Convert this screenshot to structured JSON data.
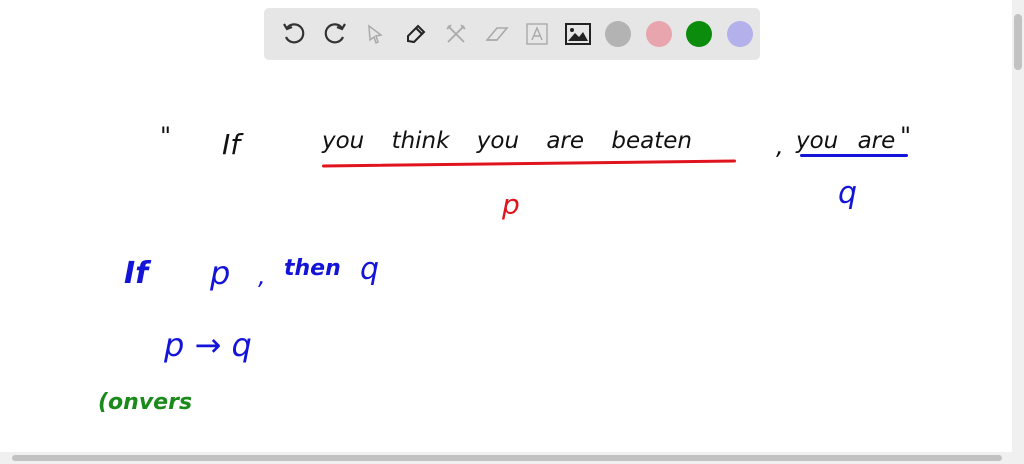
{
  "toolbar": {
    "tools": [
      "undo-icon",
      "redo-icon",
      "select-icon",
      "pen-icon",
      "tools-icon",
      "eraser-icon",
      "text-icon",
      "image-icon"
    ],
    "colors": [
      "#b3b3b3",
      "#e8a5ad",
      "#0c8c0c",
      "#b3b0ec"
    ]
  },
  "canvas": {
    "quote_open": "\"",
    "if_word": "If",
    "p_clause": "you think you are beaten",
    "comma": ",",
    "q_clause": "you are",
    "quote_close": "\"",
    "p_label": "p",
    "q_label": "q",
    "if_line": {
      "if": "If",
      "p": "p",
      "comma": ",",
      "then": "then",
      "q": "q"
    },
    "implication": "p → q",
    "converse": "(onvers"
  },
  "colors": {
    "black": "#111111",
    "red": "#e0141e",
    "blue": "#1414d8",
    "green": "#1a8a1a"
  }
}
